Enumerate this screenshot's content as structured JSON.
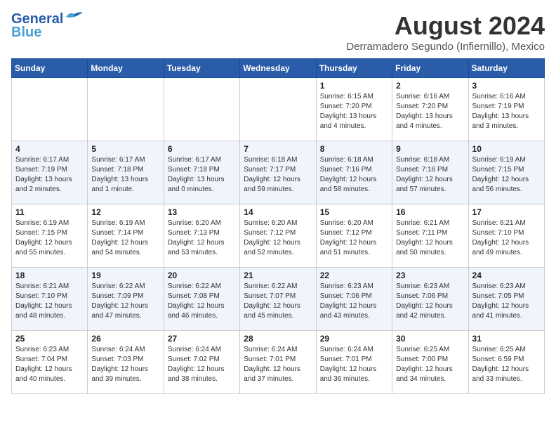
{
  "header": {
    "logo_line1": "General",
    "logo_line2": "Blue",
    "month": "August 2024",
    "location": "Derramadero Segundo (Infiernillo), Mexico"
  },
  "days_of_week": [
    "Sunday",
    "Monday",
    "Tuesday",
    "Wednesday",
    "Thursday",
    "Friday",
    "Saturday"
  ],
  "weeks": [
    [
      {
        "day": "",
        "info": ""
      },
      {
        "day": "",
        "info": ""
      },
      {
        "day": "",
        "info": ""
      },
      {
        "day": "",
        "info": ""
      },
      {
        "day": "1",
        "info": "Sunrise: 6:15 AM\nSunset: 7:20 PM\nDaylight: 13 hours\nand 4 minutes."
      },
      {
        "day": "2",
        "info": "Sunrise: 6:16 AM\nSunset: 7:20 PM\nDaylight: 13 hours\nand 4 minutes."
      },
      {
        "day": "3",
        "info": "Sunrise: 6:16 AM\nSunset: 7:19 PM\nDaylight: 13 hours\nand 3 minutes."
      }
    ],
    [
      {
        "day": "4",
        "info": "Sunrise: 6:17 AM\nSunset: 7:19 PM\nDaylight: 13 hours\nand 2 minutes."
      },
      {
        "day": "5",
        "info": "Sunrise: 6:17 AM\nSunset: 7:18 PM\nDaylight: 13 hours\nand 1 minute."
      },
      {
        "day": "6",
        "info": "Sunrise: 6:17 AM\nSunset: 7:18 PM\nDaylight: 13 hours\nand 0 minutes."
      },
      {
        "day": "7",
        "info": "Sunrise: 6:18 AM\nSunset: 7:17 PM\nDaylight: 12 hours\nand 59 minutes."
      },
      {
        "day": "8",
        "info": "Sunrise: 6:18 AM\nSunset: 7:16 PM\nDaylight: 12 hours\nand 58 minutes."
      },
      {
        "day": "9",
        "info": "Sunrise: 6:18 AM\nSunset: 7:16 PM\nDaylight: 12 hours\nand 57 minutes."
      },
      {
        "day": "10",
        "info": "Sunrise: 6:19 AM\nSunset: 7:15 PM\nDaylight: 12 hours\nand 56 minutes."
      }
    ],
    [
      {
        "day": "11",
        "info": "Sunrise: 6:19 AM\nSunset: 7:15 PM\nDaylight: 12 hours\nand 55 minutes."
      },
      {
        "day": "12",
        "info": "Sunrise: 6:19 AM\nSunset: 7:14 PM\nDaylight: 12 hours\nand 54 minutes."
      },
      {
        "day": "13",
        "info": "Sunrise: 6:20 AM\nSunset: 7:13 PM\nDaylight: 12 hours\nand 53 minutes."
      },
      {
        "day": "14",
        "info": "Sunrise: 6:20 AM\nSunset: 7:12 PM\nDaylight: 12 hours\nand 52 minutes."
      },
      {
        "day": "15",
        "info": "Sunrise: 6:20 AM\nSunset: 7:12 PM\nDaylight: 12 hours\nand 51 minutes."
      },
      {
        "day": "16",
        "info": "Sunrise: 6:21 AM\nSunset: 7:11 PM\nDaylight: 12 hours\nand 50 minutes."
      },
      {
        "day": "17",
        "info": "Sunrise: 6:21 AM\nSunset: 7:10 PM\nDaylight: 12 hours\nand 49 minutes."
      }
    ],
    [
      {
        "day": "18",
        "info": "Sunrise: 6:21 AM\nSunset: 7:10 PM\nDaylight: 12 hours\nand 48 minutes."
      },
      {
        "day": "19",
        "info": "Sunrise: 6:22 AM\nSunset: 7:09 PM\nDaylight: 12 hours\nand 47 minutes."
      },
      {
        "day": "20",
        "info": "Sunrise: 6:22 AM\nSunset: 7:08 PM\nDaylight: 12 hours\nand 46 minutes."
      },
      {
        "day": "21",
        "info": "Sunrise: 6:22 AM\nSunset: 7:07 PM\nDaylight: 12 hours\nand 45 minutes."
      },
      {
        "day": "22",
        "info": "Sunrise: 6:23 AM\nSunset: 7:06 PM\nDaylight: 12 hours\nand 43 minutes."
      },
      {
        "day": "23",
        "info": "Sunrise: 6:23 AM\nSunset: 7:06 PM\nDaylight: 12 hours\nand 42 minutes."
      },
      {
        "day": "24",
        "info": "Sunrise: 6:23 AM\nSunset: 7:05 PM\nDaylight: 12 hours\nand 41 minutes."
      }
    ],
    [
      {
        "day": "25",
        "info": "Sunrise: 6:23 AM\nSunset: 7:04 PM\nDaylight: 12 hours\nand 40 minutes."
      },
      {
        "day": "26",
        "info": "Sunrise: 6:24 AM\nSunset: 7:03 PM\nDaylight: 12 hours\nand 39 minutes."
      },
      {
        "day": "27",
        "info": "Sunrise: 6:24 AM\nSunset: 7:02 PM\nDaylight: 12 hours\nand 38 minutes."
      },
      {
        "day": "28",
        "info": "Sunrise: 6:24 AM\nSunset: 7:01 PM\nDaylight: 12 hours\nand 37 minutes."
      },
      {
        "day": "29",
        "info": "Sunrise: 6:24 AM\nSunset: 7:01 PM\nDaylight: 12 hours\nand 36 minutes."
      },
      {
        "day": "30",
        "info": "Sunrise: 6:25 AM\nSunset: 7:00 PM\nDaylight: 12 hours\nand 34 minutes."
      },
      {
        "day": "31",
        "info": "Sunrise: 6:25 AM\nSunset: 6:59 PM\nDaylight: 12 hours\nand 33 minutes."
      }
    ]
  ]
}
